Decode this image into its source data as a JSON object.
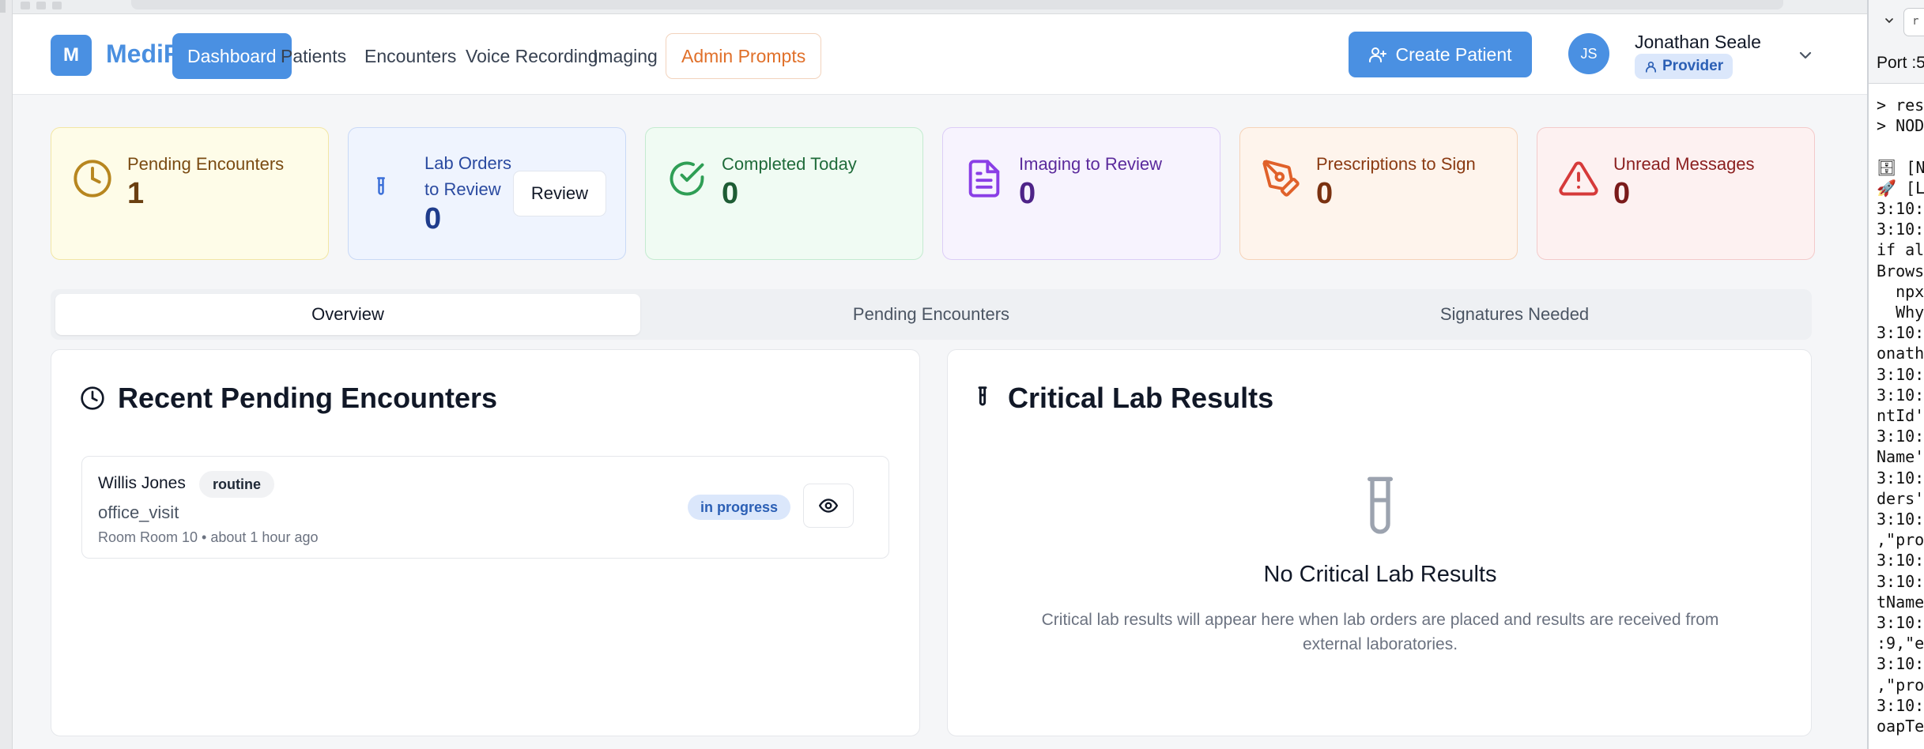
{
  "brand": {
    "logo_letter": "M",
    "name": "MediFlow"
  },
  "nav": {
    "dashboard": "Dashboard",
    "patients": "Patients",
    "encounters": "Encounters",
    "voice_recording": "Voice Recording",
    "imaging": "Imaging",
    "admin_prompts": "Admin Prompts"
  },
  "header": {
    "create_patient": "Create Patient",
    "user_initials": "JS",
    "user_name": "Jonathan Seale",
    "user_role": "Provider"
  },
  "stats": [
    {
      "label": "Pending Encounters",
      "value": "1",
      "icon": "clock-icon",
      "color": "#b7861f"
    },
    {
      "label_line1": "Lab Orders",
      "label_line2": "to Review",
      "value": "0",
      "icon": "test-tube-icon",
      "action": "Review",
      "color": "#3b6fd8"
    },
    {
      "label": "Completed Today",
      "value": "0",
      "icon": "check-circle-icon",
      "color": "#2f9e55"
    },
    {
      "label": "Imaging to Review",
      "value": "0",
      "icon": "file-text-icon",
      "color": "#8a3ee6"
    },
    {
      "label": "Prescriptions to Sign",
      "value": "0",
      "icon": "pen-tool-icon",
      "color": "#e0612a"
    },
    {
      "label": "Unread Messages",
      "value": "0",
      "icon": "alert-triangle-icon",
      "color": "#d63a3a"
    }
  ],
  "tabs": {
    "overview": "Overview",
    "pending": "Pending Encounters",
    "signatures": "Signatures Needed"
  },
  "recent": {
    "title": "Recent Pending Encounters",
    "items": [
      {
        "patient": "Willis Jones",
        "priority": "routine",
        "type": "office_visit",
        "meta": "Room Room 10 • about 1 hour ago",
        "status": "in progress"
      }
    ]
  },
  "critical": {
    "title": "Critical Lab Results",
    "empty_title": "No Critical Lab Results",
    "empty_desc_line1": "Critical lab results will appear here when lab orders are placed and results are received from",
    "empty_desc_line2": "external laboratories."
  },
  "terminal": {
    "port": "Port :5",
    "tab_label": "r",
    "lines": [
      "> res",
      "> NOD",
      "",
      "🗄 [N",
      "🚀 [L",
      "3:10:",
      "3:10:",
      "if al",
      "Brows",
      "  npx",
      "  Why",
      "3:10:",
      "onath",
      "3:10:",
      "3:10:",
      "ntId'",
      "3:10:",
      "Name'",
      "3:10:",
      "ders'",
      "3:10:",
      ",\"pro",
      "3:10:",
      "3:10:",
      "tName",
      "3:10:",
      ":9,\"e",
      "3:10:",
      ",\"pro",
      "3:10:",
      "oapTe"
    ]
  }
}
